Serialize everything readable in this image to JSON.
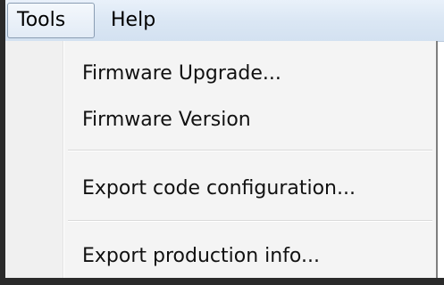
{
  "menubar": {
    "tools_label": "Tools",
    "help_label": "Help"
  },
  "tools_menu": {
    "items": [
      {
        "label": "Firmware Upgrade..."
      },
      {
        "label": "Firmware Version"
      },
      {
        "label": "Export code configuration..."
      },
      {
        "label": "Export production info..."
      }
    ]
  }
}
